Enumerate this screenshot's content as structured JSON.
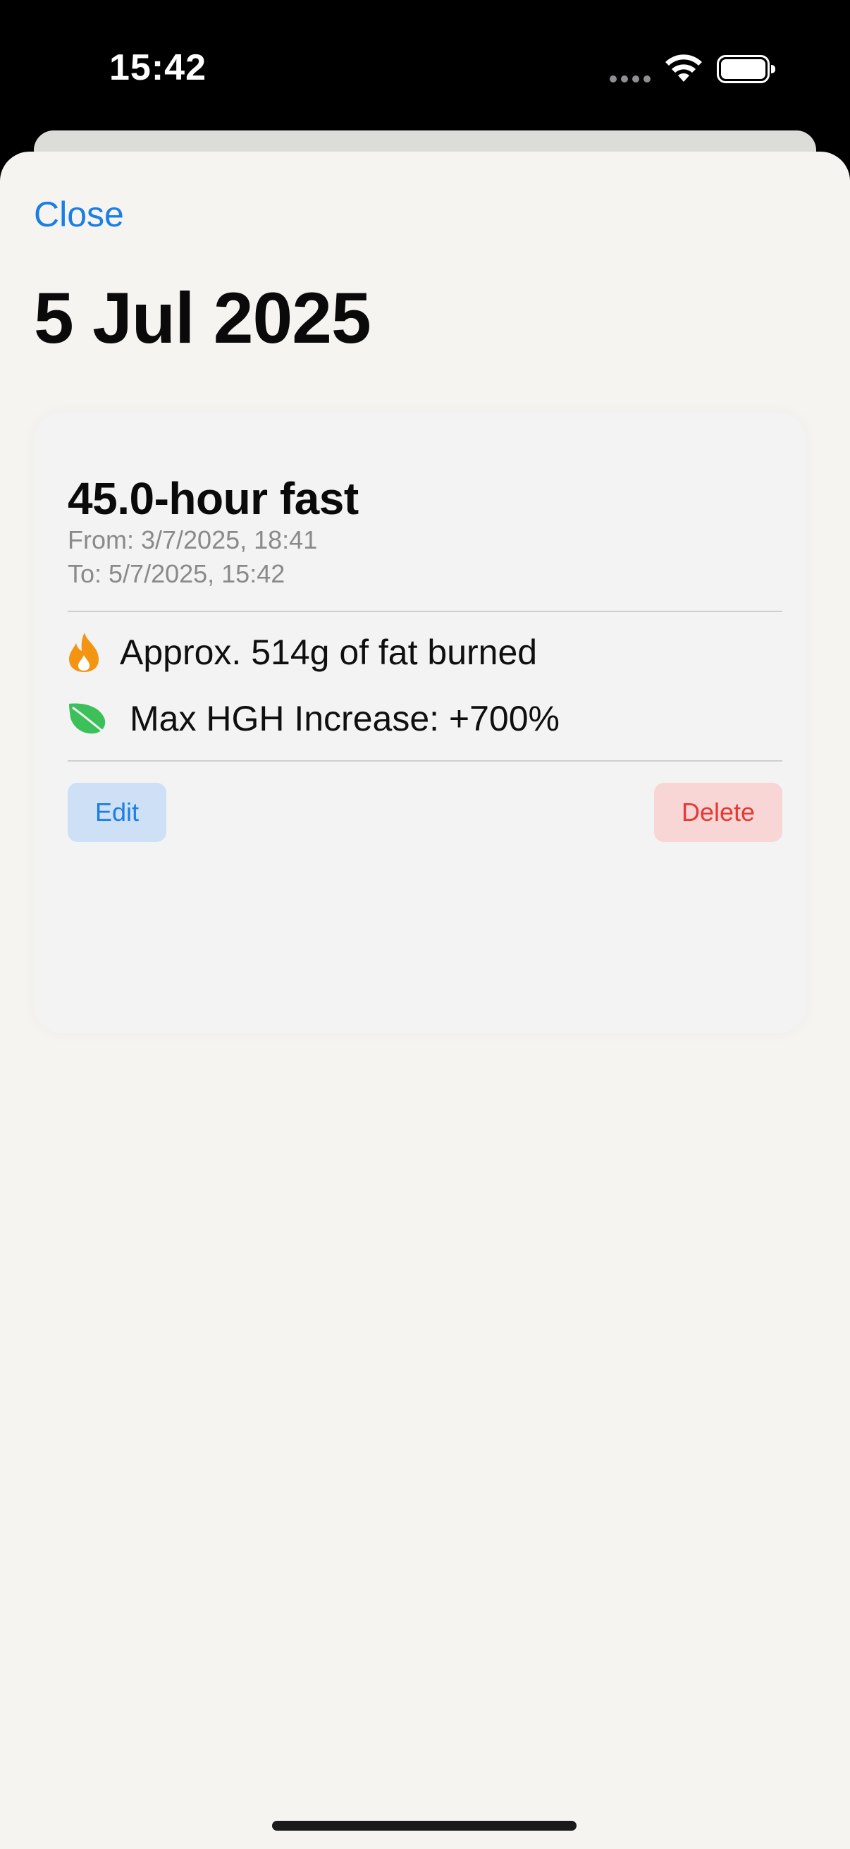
{
  "status_bar": {
    "time": "15:42",
    "icons": [
      "signal-dots-icon",
      "wifi-icon",
      "battery-icon"
    ]
  },
  "sheet": {
    "close_label": "Close",
    "title": "5 Jul 2025"
  },
  "fast_card": {
    "title": "45.0-hour fast",
    "from": "From: 3/7/2025, 18:41",
    "to": "To: 5/7/2025, 15:42",
    "stats": [
      {
        "icon": "flame-icon",
        "text": "Approx. 514g of fat burned"
      },
      {
        "icon": "leaf-icon",
        "text": "Max HGH Increase: +700%"
      }
    ],
    "edit_label": "Edit",
    "delete_label": "Delete"
  },
  "colors": {
    "accent": "#1a7ee6",
    "destructive": "#e53935",
    "flame": "#f39412",
    "leaf": "#3cc05a",
    "sheet_background": "#f5f4f1"
  }
}
